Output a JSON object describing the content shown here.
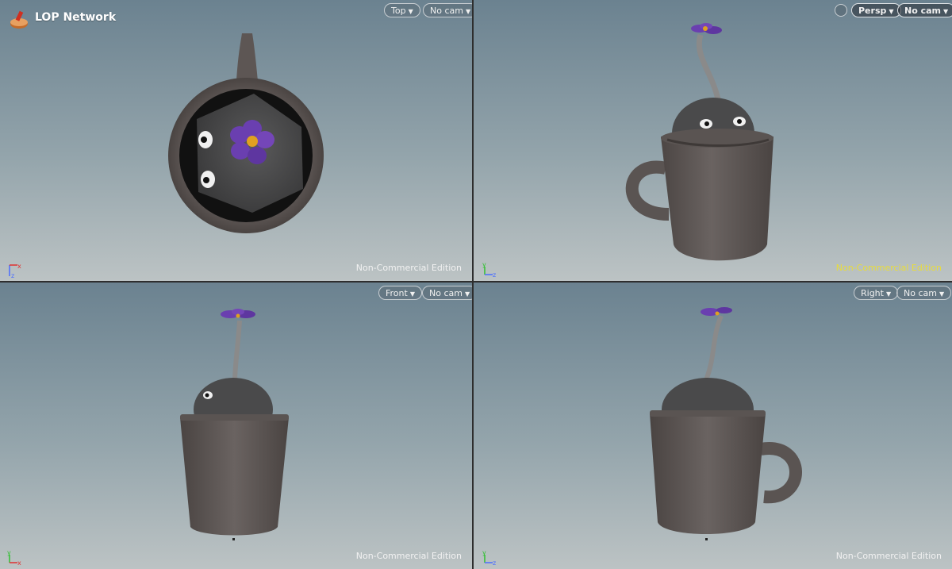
{
  "app": {
    "network_title": "LOP Network"
  },
  "viewports": {
    "top": {
      "view_label": "Top",
      "camera_label": "No cam",
      "watermark": "Non-Commercial Edition",
      "axes": [
        "x",
        "z"
      ]
    },
    "persp": {
      "view_label": "Persp",
      "camera_label": "No cam",
      "watermark": "Non-Commercial Edition",
      "axes": [
        "y",
        "z"
      ]
    },
    "front": {
      "view_label": "Front",
      "camera_label": "No cam",
      "watermark": "Non-Commercial Edition",
      "axes": [
        "y",
        "x"
      ]
    },
    "right": {
      "view_label": "Right",
      "camera_label": "No cam",
      "watermark": "Non-Commercial Edition",
      "axes": [
        "y",
        "z"
      ]
    }
  },
  "colors": {
    "mug": "#5b5553",
    "creature": "#4a4a4b",
    "flower": "#6a3fb0",
    "flower_center": "#e0a020",
    "persp_watermark": "#e8dc3c"
  }
}
